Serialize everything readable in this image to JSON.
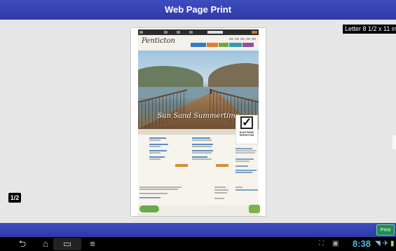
{
  "header": {
    "title": "Web Page Print"
  },
  "preview": {
    "paper_size": "Letter 8 1/2 x 11 in",
    "page_indicator": "1/2"
  },
  "webpage": {
    "site_name": "Penticton",
    "hero_tagline": "Sun Sand Summertime",
    "ballot_text": "ELECTIONS PENTICTON",
    "ballot_check": "✓"
  },
  "actions": {
    "print_label": "Print"
  },
  "system_bar": {
    "nav_icons": [
      "back-icon",
      "home-icon",
      "recent-apps-icon",
      "menu-icon"
    ],
    "clock": "8:38"
  }
}
